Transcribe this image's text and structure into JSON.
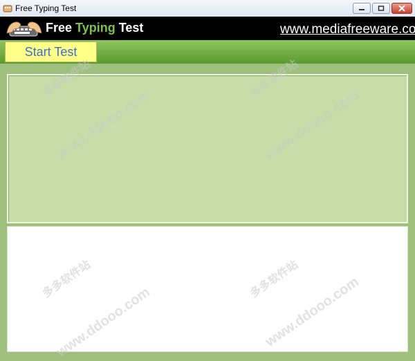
{
  "window": {
    "title": "Free Typing Test",
    "controls": {
      "minimize": "minimize",
      "maximize": "maximize",
      "close": "close"
    }
  },
  "banner": {
    "brand_word1": "Free ",
    "brand_word2": "Typing",
    "brand_word3": " Test",
    "site_link": "www.mediafreeware.com"
  },
  "toolbar": {
    "start_label": "Start Test"
  },
  "watermark": {
    "domain": "www.ddooo.com",
    "cn": "多多软件站"
  },
  "colors": {
    "background": "#9ec07c",
    "banner": "#000000",
    "brand_accent": "#7fc24a",
    "start_button": "#ffff88",
    "start_text": "#3b6fd0",
    "text_panel": "#c6dda7"
  }
}
